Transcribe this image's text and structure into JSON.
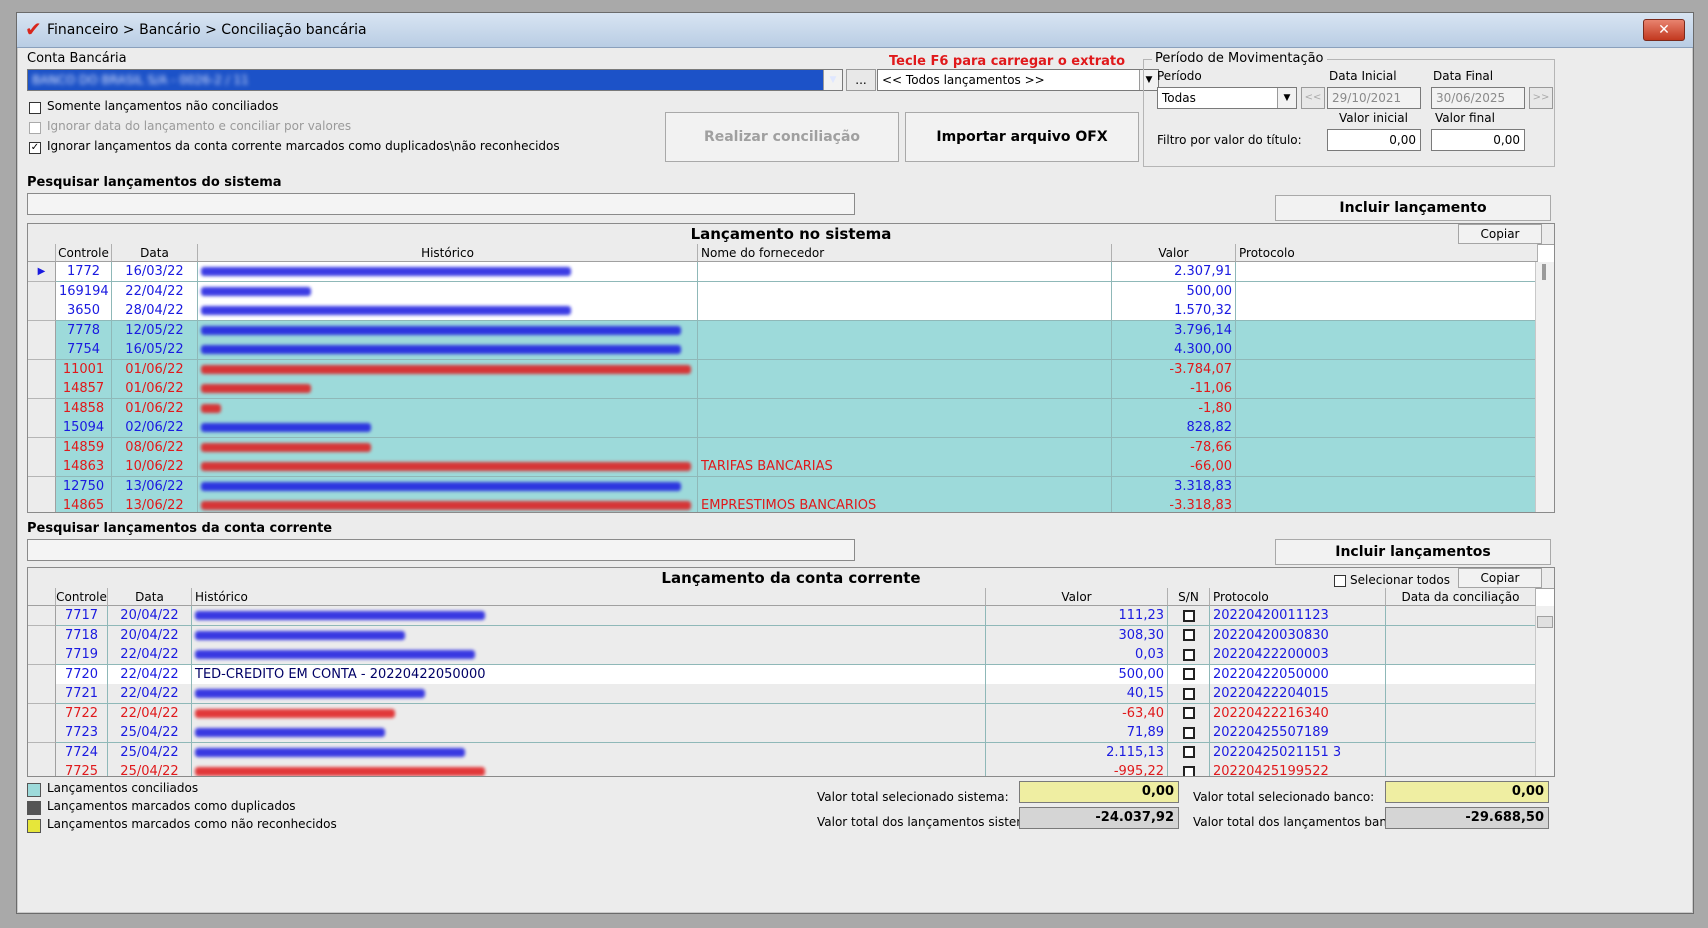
{
  "window": {
    "title": "Financeiro > Bancário > Conciliação bancária",
    "close_icon": "✕"
  },
  "account": {
    "label": "Conta Bancária",
    "selected": "BANCO DO BRASIL S/A - 0026-2 / 11",
    "more_button": "..."
  },
  "extract": {
    "hint": "Tecle F6 para carregar o extrato",
    "selected": "<< Todos lançamentos >>"
  },
  "options": {
    "only_unreconciled": "Somente lançamentos não conciliados",
    "ignore_date": "Ignorar data do lançamento e conciliar por valores",
    "ignore_duplicates": "Ignorar lançamentos da conta corrente marcados como duplicados\\não reconhecidos"
  },
  "actions": {
    "reconcile": "Realizar conciliação",
    "import_ofx": "Importar arquivo OFX"
  },
  "period": {
    "group_title": "Período de Movimentação",
    "period_label": "Período",
    "period_value": "Todas",
    "start_label": "Data Inicial",
    "start_value": "29/10/2021",
    "end_label": "Data Final",
    "end_value": "30/06/2025",
    "prev": "<<",
    "next": ">>",
    "min_label": "Valor inicial",
    "max_label": "Valor final",
    "filter_label": "Filtro por valor do título:",
    "min_value": "0,00",
    "max_value": "0,00"
  },
  "system_search": {
    "label": "Pesquisar lançamentos do sistema",
    "include_button": "Incluir lançamento"
  },
  "system_grid": {
    "title": "Lançamento no sistema",
    "copy_button": "Copiar",
    "columns": [
      "Controle",
      "Data",
      "Histórico",
      "Nome do fornecedor",
      "Valor",
      "Protocolo"
    ],
    "rows": [
      {
        "controle": "1772",
        "data": "16/03/22",
        "fornecedor": "",
        "valor": "2.307,91",
        "color": "#1a1ae0",
        "bg": "#ffffff",
        "blur_width": 370
      },
      {
        "controle": "169194",
        "data": "22/04/22",
        "fornecedor": "",
        "valor": "500,00",
        "color": "#1a1ae0",
        "bg": "#ffffff",
        "blur_width": 110
      },
      {
        "controle": "3650",
        "data": "28/04/22",
        "fornecedor": "",
        "valor": "1.570,32",
        "color": "#1a1ae0",
        "bg": "#ffffff",
        "blur_width": 370
      },
      {
        "controle": "7778",
        "data": "12/05/22",
        "fornecedor": "",
        "valor": "3.796,14",
        "color": "#1a1ae0",
        "bg": "#9ddada",
        "blur_width": 480
      },
      {
        "controle": "7754",
        "data": "16/05/22",
        "fornecedor": "",
        "valor": "4.300,00",
        "color": "#1a1ae0",
        "bg": "#9ddada",
        "blur_width": 480
      },
      {
        "controle": "11001",
        "data": "01/06/22",
        "fornecedor": "",
        "valor": "-3.784,07",
        "color": "#e0191b",
        "bg": "#9ddada",
        "blur_width": 490
      },
      {
        "controle": "14857",
        "data": "01/06/22",
        "fornecedor": "",
        "valor": "-11,06",
        "color": "#e0191b",
        "bg": "#9ddada",
        "blur_width": 110
      },
      {
        "controle": "14858",
        "data": "01/06/22",
        "fornecedor": "",
        "valor": "-1,80",
        "color": "#e0191b",
        "bg": "#9ddada",
        "blur_width": 20
      },
      {
        "controle": "15094",
        "data": "02/06/22",
        "fornecedor": "",
        "valor": "828,82",
        "color": "#1a1ae0",
        "bg": "#9ddada",
        "blur_width": 170
      },
      {
        "controle": "14859",
        "data": "08/06/22",
        "fornecedor": "",
        "valor": "-78,66",
        "color": "#e0191b",
        "bg": "#9ddada",
        "blur_width": 170
      },
      {
        "controle": "14863",
        "data": "10/06/22",
        "fornecedor": "TARIFAS BANCARIAS",
        "valor": "-66,00",
        "color": "#e0191b",
        "bg": "#9ddada",
        "blur_width": 490
      },
      {
        "controle": "12750",
        "data": "13/06/22",
        "fornecedor": "",
        "valor": "3.318,83",
        "color": "#1a1ae0",
        "bg": "#9ddada",
        "blur_width": 480
      },
      {
        "controle": "14865",
        "data": "13/06/22",
        "fornecedor": "EMPRESTIMOS BANCARIOS",
        "valor": "-3.318,83",
        "color": "#e0191b",
        "bg": "#9ddada",
        "blur_width": 490
      }
    ]
  },
  "bank_search": {
    "label": "Pesquisar lançamentos da conta corrente",
    "include_button": "Incluir lançamentos"
  },
  "bank_grid": {
    "title": "Lançamento da conta corrente",
    "select_all": "Selecionar todos",
    "copy_button": "Copiar",
    "columns": [
      "Controle",
      "Data",
      "Histórico",
      "Valor",
      "S/N",
      "Protocolo",
      "Data da conciliação"
    ],
    "rows": [
      {
        "controle": "7717",
        "data": "20/04/22",
        "historico": "",
        "valor": "111,23",
        "protocolo": "20220420011123",
        "color": "#1a1ae0",
        "blur_width": 290
      },
      {
        "controle": "7718",
        "data": "20/04/22",
        "historico": "",
        "valor": "308,30",
        "protocolo": "20220420030830",
        "color": "#1a1ae0",
        "blur_width": 210
      },
      {
        "controle": "7719",
        "data": "22/04/22",
        "historico": "",
        "valor": "0,03",
        "protocolo": "20220422200003",
        "color": "#1a1ae0",
        "blur_width": 280
      },
      {
        "controle": "7720",
        "data": "22/04/22",
        "historico": "TED-CREDITO EM CONTA - 20220422050000",
        "valor": "500,00",
        "protocolo": "20220422050000",
        "color": "#1a1ae0",
        "blur_width": 0
      },
      {
        "controle": "7721",
        "data": "22/04/22",
        "historico": "",
        "valor": "40,15",
        "protocolo": "20220422204015",
        "color": "#1a1ae0",
        "blur_width": 230
      },
      {
        "controle": "7722",
        "data": "22/04/22",
        "historico": "",
        "valor": "-63,40",
        "protocolo": "20220422216340",
        "color": "#e0191b",
        "blur_width": 200
      },
      {
        "controle": "7723",
        "data": "25/04/22",
        "historico": "",
        "valor": "71,89",
        "protocolo": "20220425507189",
        "color": "#1a1ae0",
        "blur_width": 190
      },
      {
        "controle": "7724",
        "data": "25/04/22",
        "historico": "",
        "valor": "2.115,13",
        "protocolo": "20220425021151 3",
        "color": "#1a1ae0",
        "blur_width": 270
      },
      {
        "controle": "7725",
        "data": "25/04/22",
        "historico": "",
        "valor": "-995,22",
        "protocolo": "20220425199522",
        "color": "#e0191b",
        "blur_width": 290
      }
    ]
  },
  "legend": {
    "reconciled": "Lançamentos conciliados",
    "duplicated": "Lançamentos marcados como duplicados",
    "unrecognized": "Lançamentos marcados como não reconhecidos",
    "reconciled_color": "#9ddada",
    "duplicated_color": "#555555",
    "unrecognized_color": "#e6e63a"
  },
  "totals": {
    "sel_system_label": "Valor total selecionado sistema:",
    "sel_system_value": "0,00",
    "total_system_label": "Valor total dos lançamentos sistema:",
    "total_system_value": "-24.037,92",
    "sel_bank_label": "Valor total selecionado banco:",
    "sel_bank_value": "0,00",
    "total_bank_label": "Valor total dos lançamentos banco:",
    "total_bank_value": "-29.688,50"
  }
}
